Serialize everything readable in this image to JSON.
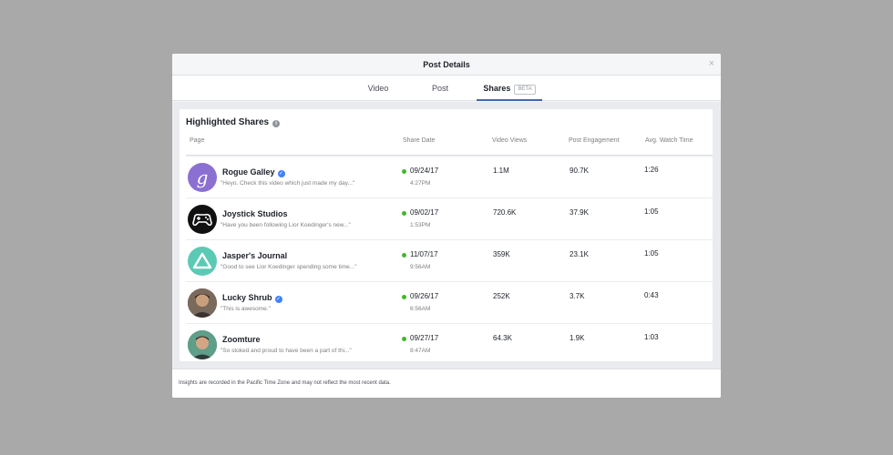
{
  "modal": {
    "title": "Post Details",
    "close_glyph": "×"
  },
  "tabs": [
    {
      "label": "Video"
    },
    {
      "label": "Post"
    },
    {
      "label": "Shares",
      "badge": "BETA"
    }
  ],
  "panel": {
    "title": "Highlighted Shares",
    "info_glyph": "i",
    "columns": [
      "Page",
      "Share Date",
      "Video Views",
      "Post Engagement",
      "Avg. Watch Time"
    ]
  },
  "rows": [
    {
      "page": "Rogue Galley",
      "verified": true,
      "quote": "\"Heyo. Check this video which just made my day...\"",
      "date": "09/24/17",
      "time": "4:27PM",
      "views": "1.1M",
      "engagement": "90.7K",
      "watch": "1:26",
      "avatar_icon": "script-g-logo",
      "avatar_color": "#8b6fd1"
    },
    {
      "page": "Joystick Studios",
      "verified": false,
      "quote": "\"Have you been following Lior Koedinger's new...\"",
      "date": "09/02/17",
      "time": "1:53PM",
      "views": "720.6K",
      "engagement": "37.9K",
      "watch": "1:05",
      "avatar_icon": "gamepad-logo",
      "avatar_color": "#111111"
    },
    {
      "page": "Jasper's Journal",
      "verified": false,
      "quote": "\"Good to see Lior Koedinger spending some time...\"",
      "date": "11/07/17",
      "time": "9:56AM",
      "views": "359K",
      "engagement": "23.1K",
      "watch": "1:05",
      "avatar_icon": "triangle-logo",
      "avatar_color": "#5cc9b5"
    },
    {
      "page": "Lucky Shrub",
      "verified": true,
      "quote": "\"This is awesome.\"",
      "date": "09/26/17",
      "time": "6:56AM",
      "views": "252K",
      "engagement": "3.7K",
      "watch": "0:43",
      "avatar_icon": "person-photo",
      "avatar_color": "#5b4a3c"
    },
    {
      "page": "Zoomture",
      "verified": false,
      "quote": "\"So stoked and proud to have been a part of thi...\"",
      "date": "09/27/17",
      "time": "8:47AM",
      "views": "64.3K",
      "engagement": "1.9K",
      "watch": "1:03",
      "avatar_icon": "person-photo",
      "avatar_color": "#4e8f7a"
    }
  ],
  "verified_glyph": "✓",
  "footer": {
    "text": "Insights are recorded in the Pacific Time Zone and may not reflect the most recent data."
  },
  "colors": {
    "accent": "#4267b2",
    "status_green": "#42b72a",
    "verified_blue": "#4080ff"
  }
}
